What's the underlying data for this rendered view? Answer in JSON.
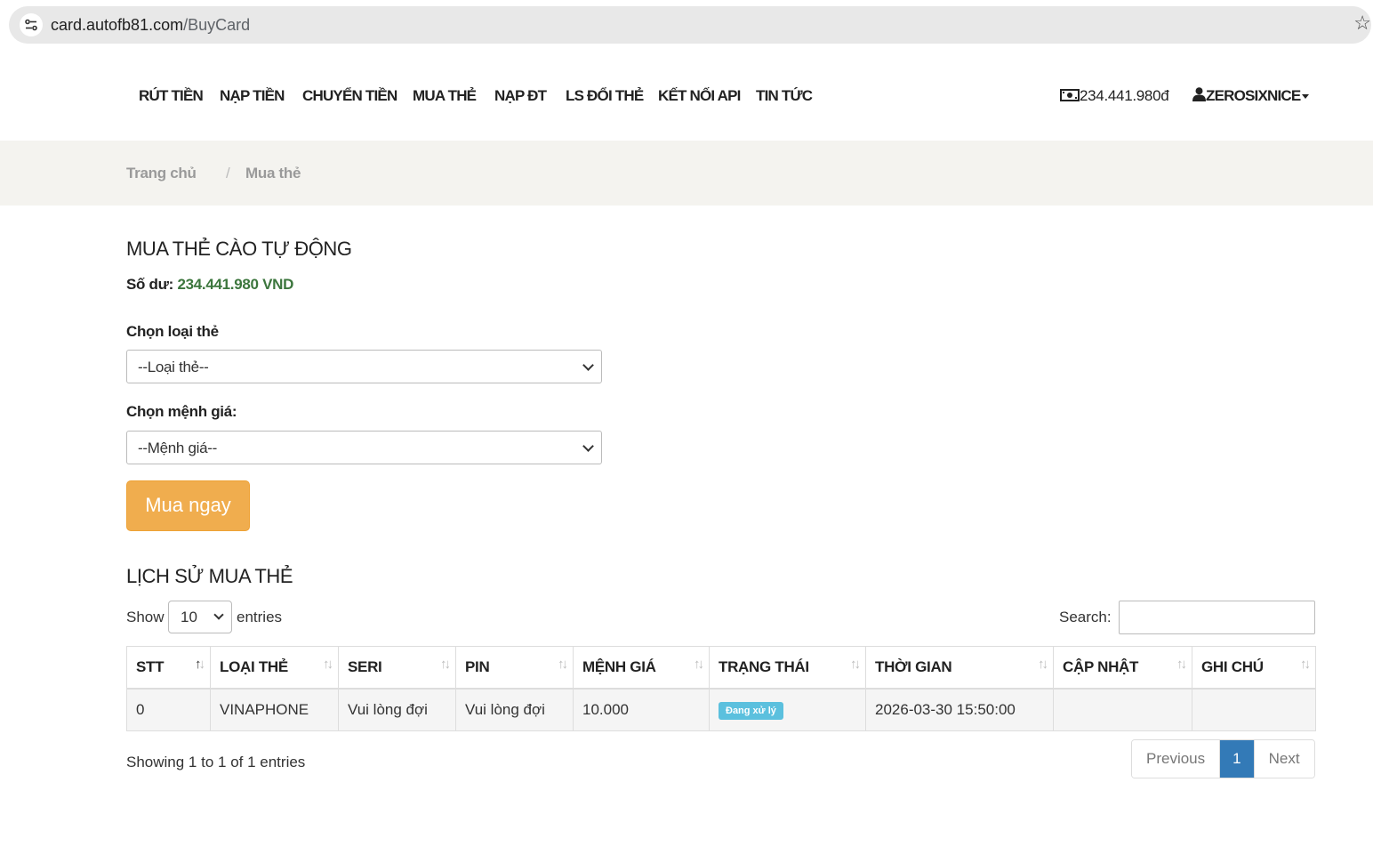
{
  "browser": {
    "url_host": "card.autofb81.com",
    "url_path": "/BuyCard"
  },
  "nav": {
    "items": [
      "RÚT TIỀN",
      "NẠP TIỀN",
      "CHUYỂN TIỀN",
      "MUA THẺ",
      "NẠP ĐT",
      "LS ĐỔI THẺ",
      "KẾT NỐI API",
      "TIN TỨC"
    ],
    "balance": "234.441.980đ",
    "username": "ZEROSIXNICE"
  },
  "breadcrumb": {
    "home": "Trang chủ",
    "separator": "/",
    "current": "Mua thẻ"
  },
  "buy_section": {
    "title": "MUA THẺ CÀO TỰ ĐỘNG",
    "balance_label": "Số dư:",
    "balance_value": "234.441.980 VND",
    "card_type_label": "Chọn loại thẻ",
    "card_type_value": "--Loại thẻ--",
    "denomination_label": "Chọn mệnh giá:",
    "denomination_value": "--Mệnh giá--",
    "buy_button": "Mua ngay"
  },
  "history": {
    "title": "LỊCH SỬ MUA THẺ",
    "show_label": "Show",
    "entries_per_page": "10",
    "entries_label": "entries",
    "search_label": "Search:",
    "search_value": "",
    "columns": [
      "STT",
      "LOẠI THẺ",
      "SERI",
      "PIN",
      "MỆNH GIÁ",
      "TRẠNG THÁI",
      "THỜI GIAN",
      "CẬP NHẬT",
      "GHI CHÚ"
    ],
    "rows": [
      {
        "stt": "0",
        "card_type": "VINAPHONE",
        "seri": "Vui lòng đợi",
        "pin": "Vui lòng đợi",
        "denomination": "10.000",
        "status": "Đang xử lý",
        "time": "2026-03-30 15:50:00",
        "updated": "",
        "note": ""
      }
    ],
    "info": "Showing 1 to 1 of 1 entries",
    "pagination": {
      "previous": "Previous",
      "current_page": "1",
      "next": "Next"
    }
  },
  "colors": {
    "buy_button": "#f0ad4e",
    "balance_amount": "#3c763d",
    "status_badge": "#5bc0de",
    "active_page": "#337ab7",
    "breadcrumb_bg": "#f4f3ef"
  }
}
